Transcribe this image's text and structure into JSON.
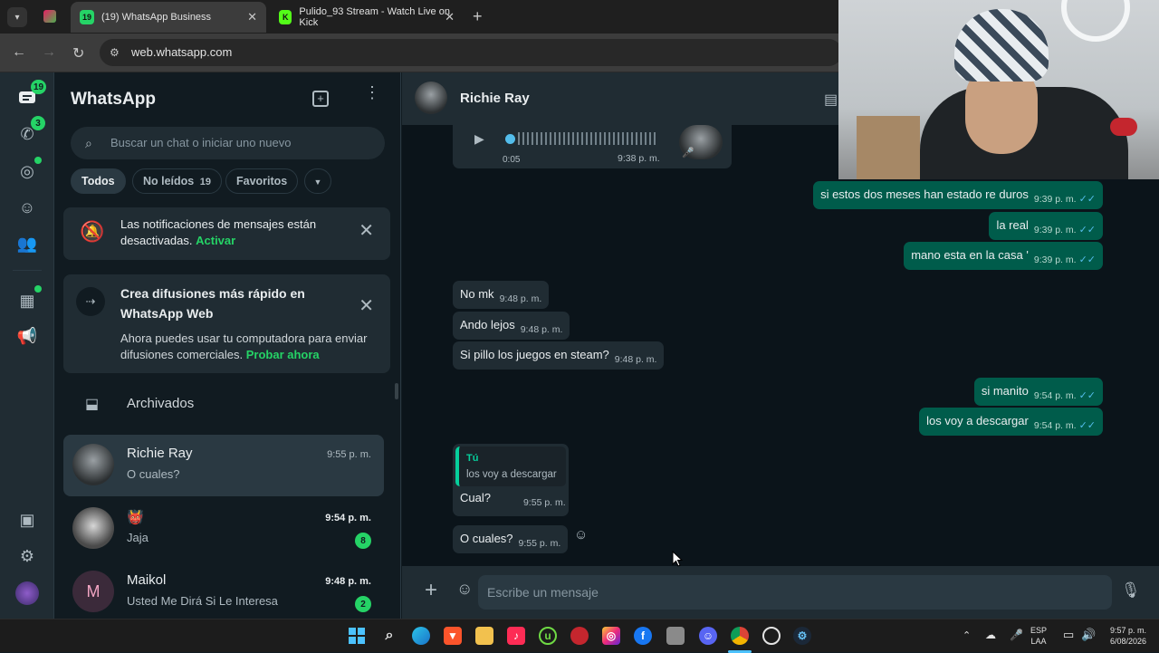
{
  "browser": {
    "tabs": [
      {
        "title": "(19) WhatsApp Business",
        "badge": "19",
        "active": true
      },
      {
        "title": "Pulido_93 Stream - Watch Live on Kick",
        "badge": "K",
        "active": false
      }
    ],
    "url": "web.whatsapp.com"
  },
  "rail": {
    "chats_badge": "19",
    "calls_badge": "3"
  },
  "sidebar": {
    "title": "WhatsApp",
    "search_placeholder": "Buscar un chat o iniciar uno nuevo",
    "filters": [
      {
        "label": "Todos"
      },
      {
        "label": "No leídos",
        "count": "19"
      },
      {
        "label": "Favoritos"
      }
    ],
    "notif_card": {
      "text": "Las notificaciones de mensajes están desactivadas.",
      "action": "Activar"
    },
    "promo_card": {
      "title": "Crea difusiones más rápido en WhatsApp Web",
      "text": "Ahora puedes usar tu computadora para enviar difusiones comerciales.",
      "action": "Probar ahora"
    },
    "archived_label": "Archivados",
    "chats": [
      {
        "name": "Richie Ray",
        "last": "O cuales?",
        "time": "9:55 p. m.",
        "unread": ""
      },
      {
        "name": "👹",
        "last": "Jaja",
        "time": "9:54 p. m.",
        "unread": "8"
      },
      {
        "name": "Maikol",
        "initial": "M",
        "last": "Usted Me Dirá Si Le Interesa",
        "time": "9:48 p. m.",
        "unread": "2"
      }
    ]
  },
  "conversation": {
    "contact": "Richie Ray",
    "voice_note": {
      "duration": "0:05",
      "time": "9:38 p. m."
    },
    "messages": [
      {
        "dir": "out",
        "text": "si estos dos meses han estado re duros",
        "time": "9:39 p. m."
      },
      {
        "dir": "out",
        "text": "la real",
        "time": "9:39 p. m."
      },
      {
        "dir": "out",
        "text": "mano esta en la casa '",
        "time": "9:39 p. m."
      },
      {
        "dir": "in",
        "text": "No mk",
        "time": "9:48 p. m."
      },
      {
        "dir": "in",
        "text": "Ando lejos",
        "time": "9:48 p. m."
      },
      {
        "dir": "in",
        "text": "Si pillo los juegos en steam?",
        "time": "9:48 p. m."
      },
      {
        "dir": "out",
        "text": "si manito",
        "time": "9:54 p. m."
      },
      {
        "dir": "out",
        "text": "los voy a descargar",
        "time": "9:54 p. m."
      },
      {
        "dir": "in",
        "text": "Cual?",
        "time": "9:55 p. m.",
        "quote_author": "Tú",
        "quote_text": "los voy a descargar"
      },
      {
        "dir": "in",
        "text": "O cuales?",
        "time": "9:55 p. m."
      }
    ],
    "composer_placeholder": "Escribe un mensaje"
  },
  "taskbar": {
    "lang": "ESP",
    "layout": "LAA",
    "time": "9:57 p. m.",
    "date": "6/08/2026"
  },
  "colors": {
    "accent": "#25d366",
    "outgoing_bubble": "#005c4b",
    "incoming_bubble": "#202c33",
    "background": "#0b141a"
  }
}
